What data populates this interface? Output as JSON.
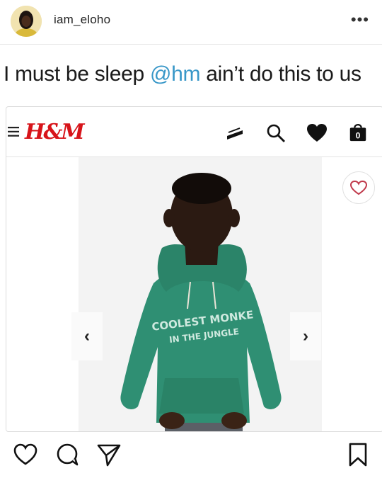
{
  "post": {
    "username": "iam_eloho",
    "more_label": "•••",
    "caption_pre": "I must be sleep ",
    "caption_mention": "@hm",
    "caption_post": " ain’t do this to us"
  },
  "hm": {
    "logo": "H&M",
    "bag_count": "0",
    "prev_label": "‹",
    "next_label": "›",
    "hoodie_text_line1": "COOLEST MONKE",
    "hoodie_text_line2": "IN THE JUNGLE"
  },
  "colors": {
    "hm_red": "#d7141a",
    "mention_blue": "#3897c8",
    "hoodie_green": "#2f8f73"
  },
  "icons": {
    "post_actions": [
      "heart-icon",
      "comment-icon",
      "share-icon",
      "bookmark-icon"
    ],
    "hm_bar": [
      "menu-icon",
      "store-icon",
      "search-icon",
      "wishlist-icon",
      "bag-icon"
    ]
  }
}
